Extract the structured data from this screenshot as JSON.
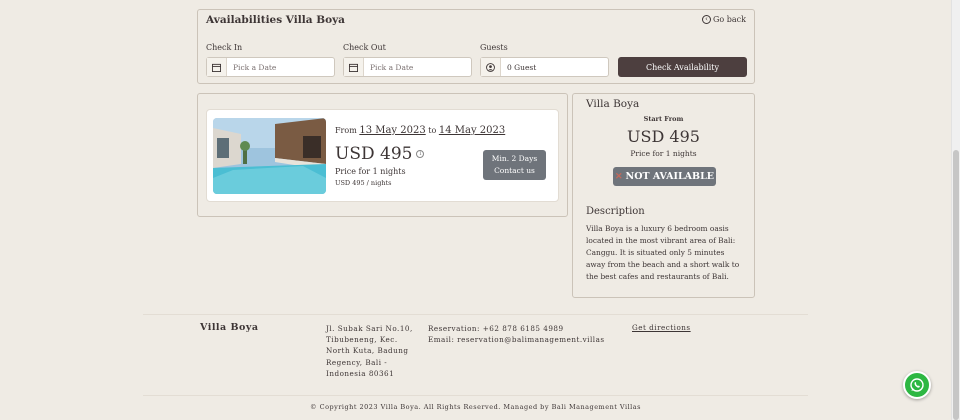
{
  "availability": {
    "title": "Availabilities Villa Boya",
    "go_back": "Go back",
    "check_in_label": "Check In",
    "check_in_placeholder": "Pick a Date",
    "check_out_label": "Check Out",
    "check_out_placeholder": "Pick a Date",
    "guests_label": "Guests",
    "guests_value": "0 Guest",
    "check_button": "Check Availability"
  },
  "listing": {
    "from_word": "From",
    "start_date": "13 May 2023",
    "to_word": "to",
    "end_date": "14 May 2023",
    "price": "USD 495",
    "price_for": "Price for 1 nights",
    "per_night": "USD 495 / nights",
    "min_days": "Min. 2 Days",
    "contact": "Contact us"
  },
  "summary": {
    "villa_name": "Villa Boya",
    "start_from": "Start From",
    "price": "USD 495",
    "price_for": "Price for 1 nights",
    "status": "NOT AVAILABLE",
    "description_heading": "Description",
    "description": "Villa Boya is a luxury 6 bedroom oasis located in the most vibrant area of Bali: Canggu. It is situated only 5 minutes away from the beach and a short walk to the best cafes and restaurants of Bali."
  },
  "footer": {
    "brand": "Villa Boya",
    "address": "Jl. Subak Sari No.10, Tibubeneng, Kec. North Kuta, Badung Regency, Bali - Indonesia 80361",
    "reservation": "Reservation: +62 878 6185 4989",
    "email": "Email: reservation@balimanagement.villas",
    "directions": "Get directions",
    "copyright": "© Copyright 2023 Villa Boya. All Rights Reserved. Managed by Bali Management Villas"
  },
  "colors": {
    "background": "#efebe4",
    "primary_button": "#4d3f3f",
    "grey_button": "#6f747b",
    "whatsapp": "#2db742"
  }
}
